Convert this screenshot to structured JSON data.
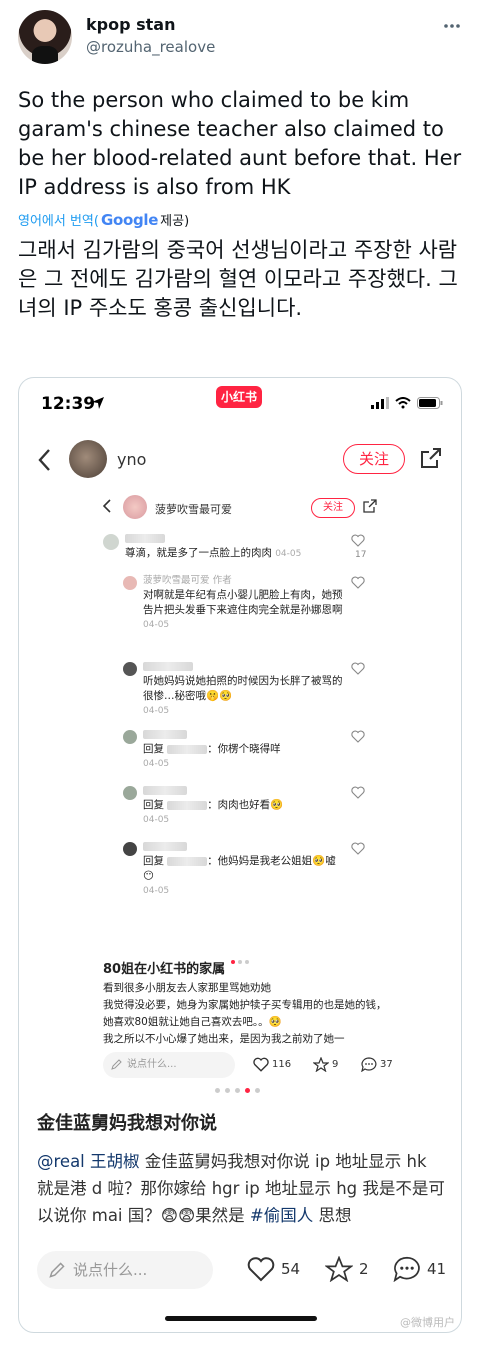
{
  "tweet": {
    "display_name": "kpop stan",
    "handle": "@rozuha_realove",
    "text": "So the person who claimed to be kim garam's chinese teacher also claimed to be her blood-related aunt before that. Her IP address is also from HK",
    "translate_prefix": "영어에서 번역(",
    "translate_brand": "Google",
    "translate_suffix": " 제공)",
    "translated_text": "그래서 김가람의 중국어 선생님이라고 주장한 사람은 그 전에도 김가람의 혈연 이모라고 주장했다. 그녀의 IP 주소도 홍콩 출신입니다."
  },
  "phone": {
    "time": "12:39",
    "app_badge": "小红书",
    "nav": {
      "username": "yno",
      "follow_label": "关注"
    },
    "inner": {
      "username": "菠萝吹雪最可爱",
      "follow_label": "关注",
      "comments": [
        {
          "text": "尊滴，就是多了一点脸上的肉肉",
          "date": "04-05",
          "likes": "17"
        },
        {
          "name": "菠萝吹雪最可爱",
          "role": "作者",
          "text": "对啊就是年纪有点小婴儿肥脸上有肉，她预告片把头发垂下来遮住肉完全就是孙娜恩啊",
          "date": "04-05"
        },
        {
          "text": "听她妈妈说她拍照的时候因为长胖了被骂的很惨…秘密哦🤫🥺",
          "date": "04-05"
        },
        {
          "prefix": "回复",
          "text": "：你楞个晓得咩",
          "date": "04-05"
        },
        {
          "prefix": "回复",
          "text": "：肉肉也好看🥺",
          "date": "04-05"
        },
        {
          "prefix": "回复",
          "text": "：他妈妈是我老公姐姐🥺嘘😶",
          "date": "04-05"
        }
      ],
      "post_title": "80姐在小红书的家属",
      "post_body": "看到很多小朋友去人家那里骂她劝她\n我觉得没必要，她身为家属她护犊子买专辑用的也是她的钱，她喜欢80姐就让她自己喜欢去吧。。🥺\n我之所以不小心爆了她出来，是因为我之前劝了她一",
      "input_placeholder": "说点什么...",
      "likes": "116",
      "stars": "9",
      "comments_count": "37"
    },
    "post_title": "金佳蓝舅妈我想对你说",
    "post_body": {
      "mention": "@real 王胡椒",
      "text1": " 金佳蓝舅妈我想对你说 ip 地址显示 hk 就是港 d 啦？那你嫁给 hgr ip 地址显示 hg 我是不是可以说你 mai 国？😨😨果然是 ",
      "hashtag": "#偷国人",
      "text2": " 思想"
    },
    "input_placeholder": "说点什么...",
    "likes": "54",
    "stars": "2",
    "comments": "41",
    "watermark": "@微博用户"
  },
  "colors": {
    "accent": "#ff2442",
    "twitter_blue": "#1d9bf0"
  }
}
